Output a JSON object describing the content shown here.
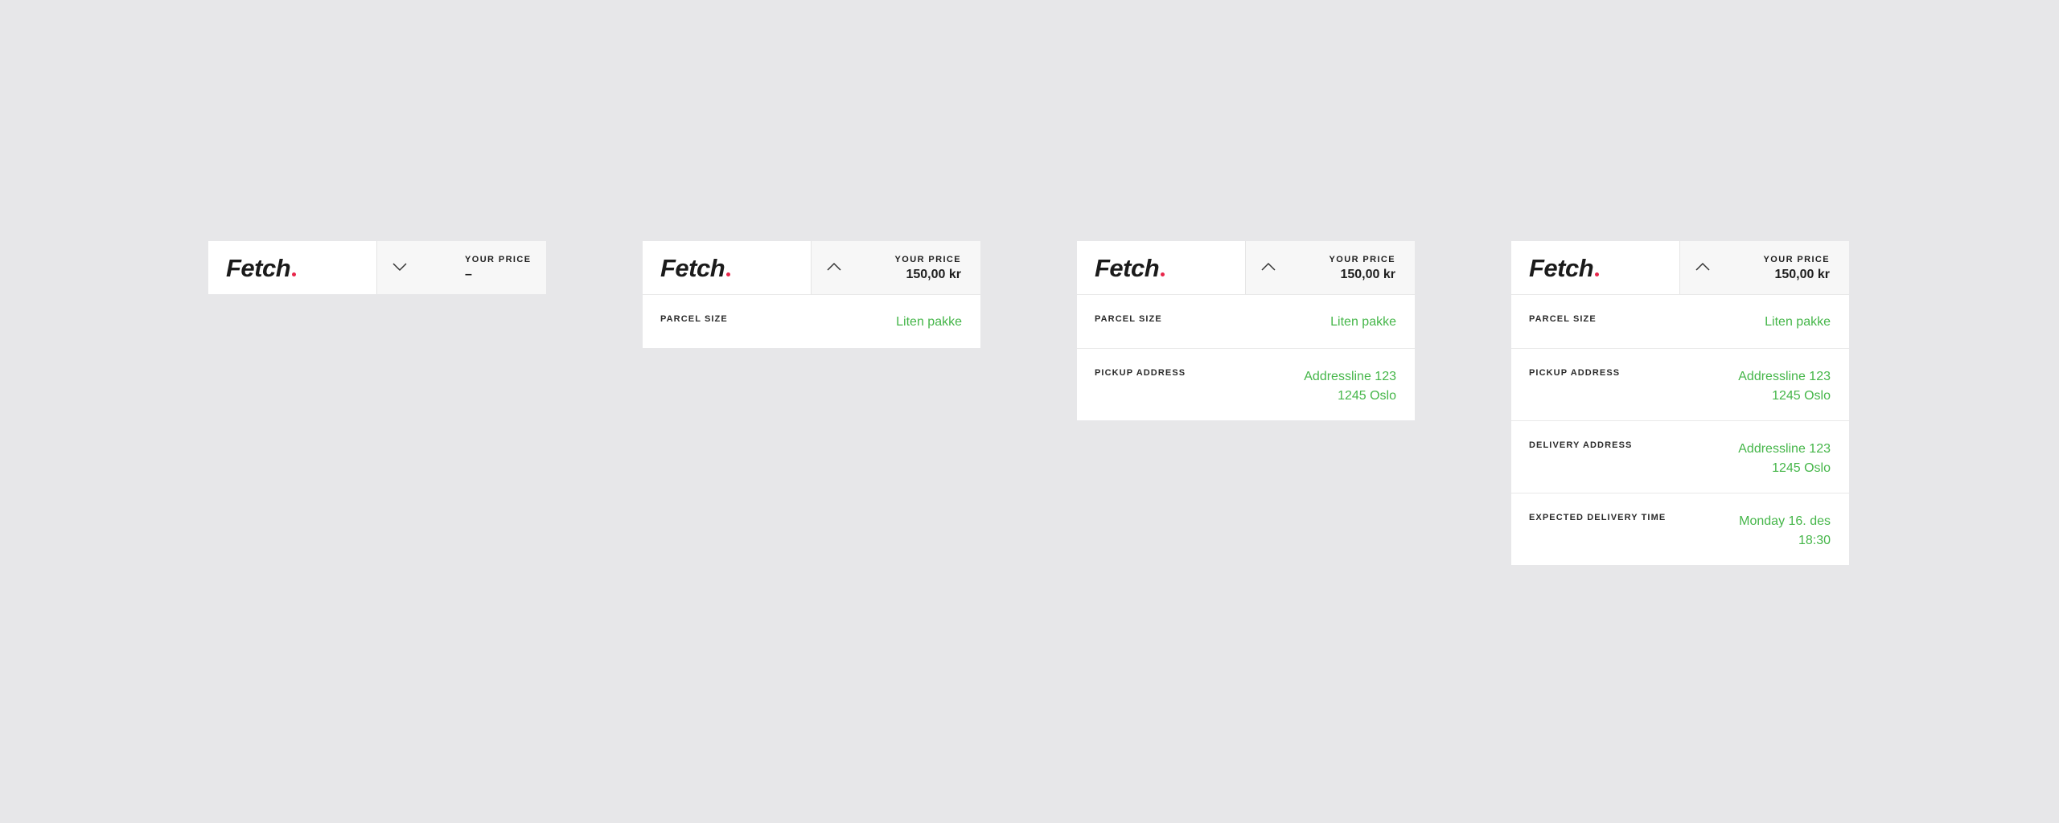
{
  "colors": {
    "background": "#e7e7e9",
    "card": "#ffffff",
    "price_cell": "#f7f7f7",
    "value_green": "#45b649",
    "logo_dot": "#e8264a",
    "text_dark": "#1f1f1f"
  },
  "widgets": [
    {
      "state": "collapsed",
      "logo": "Fetch",
      "toggle_icon": "chevron-down-icon",
      "price_label": "YOUR PRICE",
      "price_value": "–",
      "rows": []
    },
    {
      "state": "expanded",
      "logo": "Fetch",
      "toggle_icon": "chevron-up-icon",
      "price_label": "YOUR PRICE",
      "price_value": "150,00 kr",
      "rows": [
        {
          "label": "PARCEL SIZE",
          "value_lines": [
            "Liten pakke"
          ]
        }
      ]
    },
    {
      "state": "expanded",
      "logo": "Fetch",
      "toggle_icon": "chevron-up-icon",
      "price_label": "YOUR PRICE",
      "price_value": "150,00 kr",
      "rows": [
        {
          "label": "PARCEL SIZE",
          "value_lines": [
            "Liten pakke"
          ]
        },
        {
          "label": "PICKUP ADDRESS",
          "value_lines": [
            "Addressline 123",
            "1245 Oslo"
          ]
        }
      ]
    },
    {
      "state": "expanded",
      "logo": "Fetch",
      "toggle_icon": "chevron-up-icon",
      "price_label": "YOUR PRICE",
      "price_value": "150,00 kr",
      "rows": [
        {
          "label": "PARCEL SIZE",
          "value_lines": [
            "Liten pakke"
          ]
        },
        {
          "label": "PICKUP ADDRESS",
          "value_lines": [
            "Addressline 123",
            "1245 Oslo"
          ]
        },
        {
          "label": "DELIVERY ADDRESS",
          "value_lines": [
            "Addressline 123",
            "1245 Oslo"
          ]
        },
        {
          "label": "EXPECTED DELIVERY TIME",
          "value_lines": [
            "Monday 16. des",
            "18:30"
          ]
        }
      ]
    }
  ]
}
